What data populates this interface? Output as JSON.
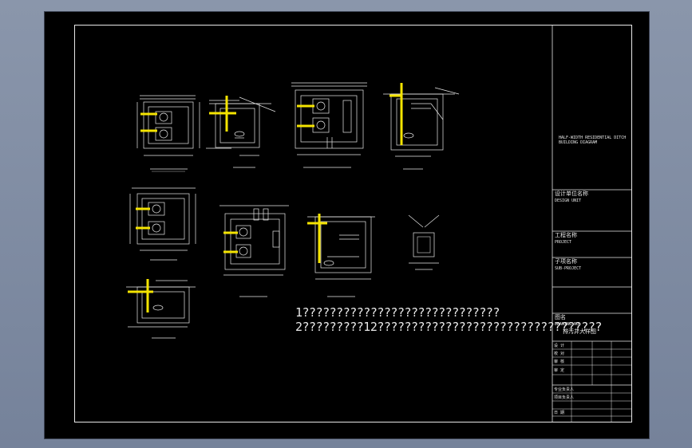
{
  "notes": {
    "note1": "1?????????????????????????????",
    "note2": "2?????????12?????????????????????????????????"
  },
  "title_block": {
    "project_en": "HALF-WIDTH RESIDENTIAL DITCH BUILDING DIAGRAM",
    "designer_label": "设计单位名称",
    "designer_en": "DESIGN UNIT",
    "project_label": "工程名称",
    "project_label_en": "PROJECT",
    "sub_label": "子项名称",
    "sub_label_en": "SUB-PROJECT",
    "drawing_label": "图名",
    "drawing_en": "DRAWING NO.",
    "drawing_title": "排污井大样图",
    "stamp_rows": [
      "设 计",
      "校 对",
      "审 核",
      "审 定",
      "专业负责人",
      "项目负责人",
      "日 期"
    ],
    "stamp_values": [
      "",
      "",
      "",
      "",
      "",
      "",
      ""
    ]
  },
  "colors": {
    "line": "#e8e8e8",
    "pipe": "#f5e400",
    "hatch": "#b9b9b9",
    "background": "#000000"
  }
}
